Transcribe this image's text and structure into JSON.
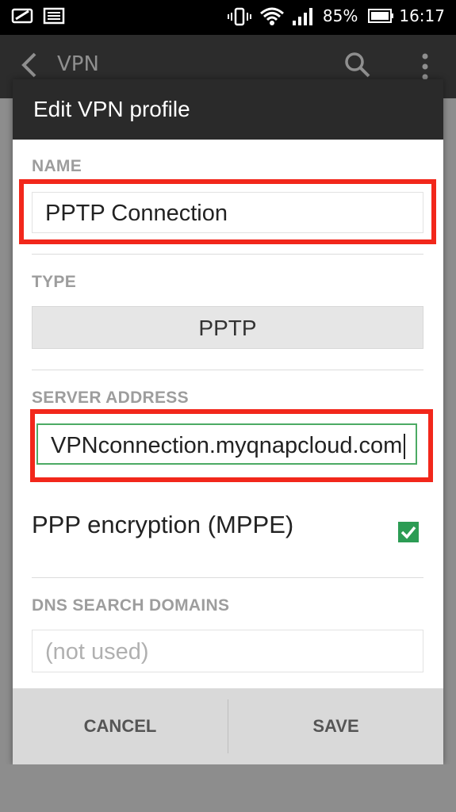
{
  "status_bar": {
    "battery": "85%",
    "time": "16:17",
    "icons": [
      "screenshot-icon",
      "image-icon",
      "vibrate-icon",
      "wifi-icon",
      "signal-icon",
      "battery-icon"
    ]
  },
  "app_bar": {
    "title": "VPN",
    "icons": [
      "back-arrow-icon",
      "search-icon",
      "more-vert-icon"
    ]
  },
  "dialog": {
    "title": "Edit VPN profile",
    "name_label": "NAME",
    "name_value": "PPTP Connection",
    "type_label": "TYPE",
    "type_value": "PPTP",
    "server_label": "SERVER ADDRESS",
    "server_value": "VPNconnection.myqnapcloud.com",
    "encryption_label": "PPP encryption (MPPE)",
    "encryption_checked": true,
    "dns_label": "DNS SEARCH DOMAINS",
    "dns_placeholder": "(not used)",
    "cancel_label": "CANCEL",
    "save_label": "SAVE"
  },
  "colors": {
    "highlight": "#f2271b",
    "check": "#2c9c54",
    "focus": "#4caa64"
  }
}
